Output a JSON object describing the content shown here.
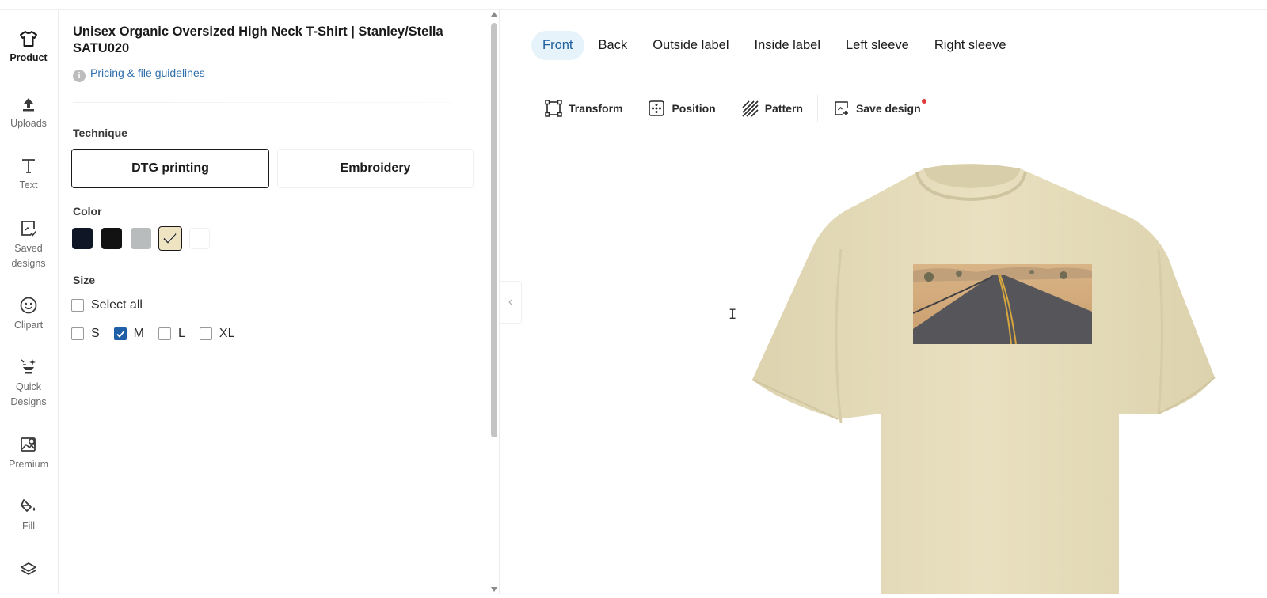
{
  "rail": {
    "items": [
      {
        "label": "Product",
        "icon": "tshirt-icon"
      },
      {
        "label": "Uploads",
        "icon": "upload-icon"
      },
      {
        "label": "Text",
        "icon": "text-icon"
      },
      {
        "label": "Saved\ndesigns",
        "icon": "saved-designs-icon"
      },
      {
        "label": "Clipart",
        "icon": "smiley-icon"
      },
      {
        "label": "Quick\nDesigns",
        "icon": "quick-designs-icon"
      },
      {
        "label": "Premium",
        "icon": "premium-image-icon"
      },
      {
        "label": "Fill",
        "icon": "paint-bucket-icon"
      },
      {
        "label": "",
        "icon": "layers-icon"
      }
    ]
  },
  "product": {
    "title": "Unisex Organic Oversized High Neck T-Shirt | Stanley/Stella SATU020",
    "guidelines_link": "Pricing & file guidelines",
    "technique_label": "Technique",
    "techniques": [
      "DTG printing",
      "Embroidery"
    ],
    "selected_technique": "DTG printing",
    "color_label": "Color",
    "colors": [
      "#0f1626",
      "#121212",
      "#b9bcbd",
      "#efe4c2",
      "#ffffff"
    ],
    "selected_color": "#efe4c2",
    "size_label": "Size",
    "select_all_label": "Select all",
    "sizes": [
      {
        "label": "S",
        "checked": false
      },
      {
        "label": "M",
        "checked": true
      },
      {
        "label": "L",
        "checked": false
      },
      {
        "label": "XL",
        "checked": false
      }
    ]
  },
  "canvas": {
    "tabs": [
      "Front",
      "Back",
      "Outside label",
      "Inside label",
      "Left sleeve",
      "Right sleeve"
    ],
    "active_tab": "Front",
    "toolbar": {
      "transform": "Transform",
      "position": "Position",
      "pattern": "Pattern",
      "save_design": "Save design"
    },
    "collapse_arrow": "‹",
    "cursor_glyph": "I",
    "shirt_color": "#e8dfbf",
    "accent": "#1d5e9c"
  }
}
